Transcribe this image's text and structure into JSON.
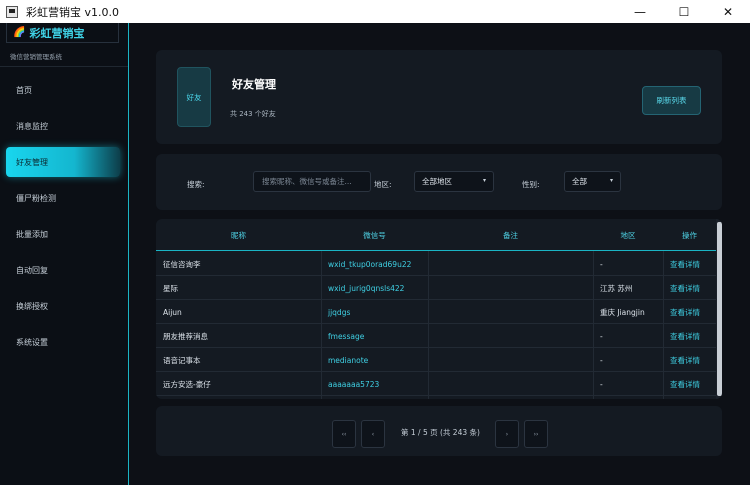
{
  "window": {
    "title": "彩虹营销宝 v1.0.0",
    "minimize": "—",
    "maximize": "☐",
    "close": "✕"
  },
  "sidebar": {
    "logo_text": "彩虹营销宝",
    "subtitle": "微信营销管理系统",
    "items": [
      {
        "label": "首页",
        "active": false
      },
      {
        "label": "消息监控",
        "active": false
      },
      {
        "label": "好友管理",
        "active": true
      },
      {
        "label": "僵尸粉检测",
        "active": false
      },
      {
        "label": "批量添加",
        "active": false
      },
      {
        "label": "自动回复",
        "active": false
      },
      {
        "label": "换绑授权",
        "active": false
      },
      {
        "label": "系统设置",
        "active": false
      }
    ]
  },
  "header": {
    "avatar_text": "好友",
    "title": "好友管理",
    "count_text": "共 243 个好友",
    "refresh_label": "刷新列表"
  },
  "filters": {
    "search_label": "搜索:",
    "search_placeholder": "搜索昵称、微信号或备注...",
    "region_label": "地区:",
    "region_value": "全部地区",
    "gender_label": "性别:",
    "gender_value": "全部"
  },
  "table": {
    "headers": [
      "昵称",
      "微信号",
      "备注",
      "地区",
      "操作"
    ],
    "rows": [
      {
        "nickname": "征信咨询李",
        "wxid": "wxid_tkup0orad69u22",
        "remark": "",
        "region": "-",
        "action": "查看详情"
      },
      {
        "nickname": "星际",
        "wxid": "wxid_jurig0qnsls422",
        "remark": "",
        "region": "江苏 苏州",
        "action": "查看详情"
      },
      {
        "nickname": "Aijun",
        "wxid": "jjqdgs",
        "remark": "",
        "region": "重庆 Jiangjin",
        "action": "查看详情"
      },
      {
        "nickname": "朋友推荐消息",
        "wxid": "fmessage",
        "remark": "",
        "region": "-",
        "action": "查看详情"
      },
      {
        "nickname": "语音记事本",
        "wxid": "medianote",
        "remark": "",
        "region": "-",
        "action": "查看详情"
      },
      {
        "nickname": "远方安选-豪仔",
        "wxid": "aaaaaaa5723",
        "remark": "",
        "region": "-",
        "action": "查看详情"
      }
    ]
  },
  "pager": {
    "first": "‹‹",
    "prev": "‹",
    "text": "第 1 / 5 页 (共 243 条)",
    "next": "›",
    "last": "››"
  },
  "colors": {
    "accent": "#19d6ee",
    "panel": "#141a22",
    "background": "#0d1016"
  }
}
